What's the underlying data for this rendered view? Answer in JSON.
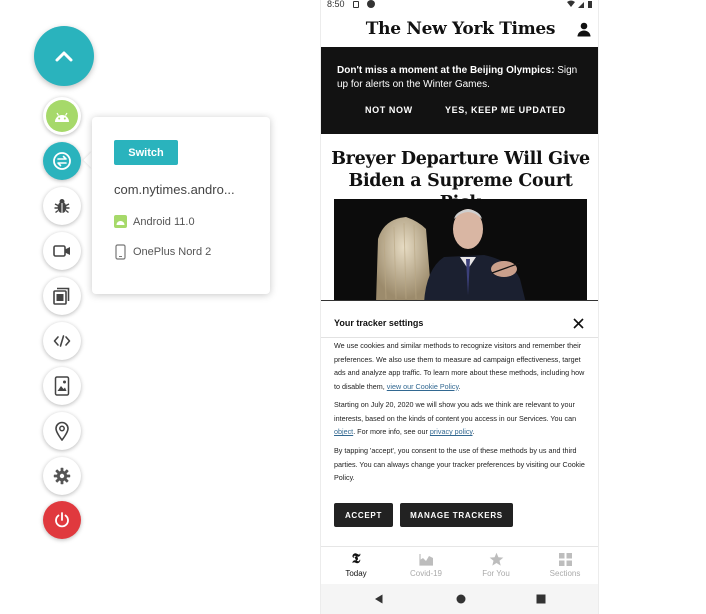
{
  "colors": {
    "teal": "#2ab3bd",
    "android_green": "#a6d96a",
    "power_red": "#e0393e",
    "nyt_banner": "#121212"
  },
  "toolbar": {
    "main_icon": "chevron-up-icon",
    "tools": [
      {
        "name": "android-icon"
      },
      {
        "name": "switch-app-icon"
      },
      {
        "name": "bug-icon"
      },
      {
        "name": "video-camera-icon"
      },
      {
        "name": "screenshots-icon"
      },
      {
        "name": "code-icon"
      },
      {
        "name": "device-image-icon"
      },
      {
        "name": "location-pin-icon"
      },
      {
        "name": "gear-icon"
      },
      {
        "name": "power-icon"
      }
    ]
  },
  "popover": {
    "switch_label": "Switch",
    "package": "com.nytimes.andro...",
    "os": "Android 11.0",
    "device": "OnePlus Nord 2"
  },
  "phone": {
    "status": {
      "time": "8:50"
    },
    "masthead": "The New York Times",
    "banner": {
      "text_bold": "Don't miss a moment at the Beijing Olympics:",
      "text_rest": " Sign up for alerts on the Winter Games.",
      "not_now": "NOT NOW",
      "keep_updated": "YES, KEEP ME UPDATED"
    },
    "headline": "Breyer Departure Will Give Biden a Supreme Court Pick",
    "tracker": {
      "title": "Your tracker settings",
      "p1": "We use cookies and similar methods to recognize visitors and remember their preferences. We also use them to measure ad campaign effectiveness, target ads and analyze app traffic. To learn more about these methods, including how to disable them, ",
      "p1_link": "view our Cookie Policy",
      "p1_end": ".",
      "p2_a": "Starting on July 20, 2020 we will show you ads we think are relevant to your interests, based on the kinds of content you access in our Services. You can ",
      "p2_link1": "object",
      "p2_b": ". For more info, see our ",
      "p2_link2": "privacy policy",
      "p2_end": ".",
      "p3": "By tapping 'accept', you consent to the use of these methods by us and third parties. You can always change your tracker preferences by visiting our Cookie Policy.",
      "accept": "ACCEPT",
      "manage": "MANAGE TRACKERS"
    },
    "bottom_nav": [
      {
        "label": "Today",
        "icon": "nyt-t-icon",
        "active": true
      },
      {
        "label": "Covid-19",
        "icon": "chart-icon",
        "active": false
      },
      {
        "label": "For You",
        "icon": "star-icon",
        "active": false
      },
      {
        "label": "Sections",
        "icon": "grid-icon",
        "active": false
      }
    ]
  }
}
